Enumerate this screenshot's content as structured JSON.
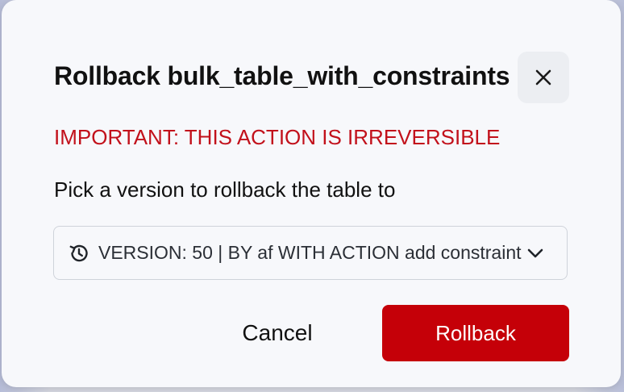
{
  "dialog": {
    "title": "Rollback bulk_table_with_constraints",
    "warning": "IMPORTANT: THIS ACTION IS IRREVERSIBLE",
    "instruction": "Pick a version to rollback the table to",
    "close_icon": "close-icon",
    "version_select": {
      "selected": "VERSION: 50 | BY af WITH ACTION add constraint",
      "leading_icon": "history-icon",
      "trailing_icon": "chevron-down-icon"
    },
    "buttons": {
      "cancel_label": "Cancel",
      "rollback_label": "Rollback"
    },
    "colors": {
      "warning_text": "#c2111b",
      "primary_button": "#c50008",
      "modal_background": "#f7f8fb"
    }
  }
}
